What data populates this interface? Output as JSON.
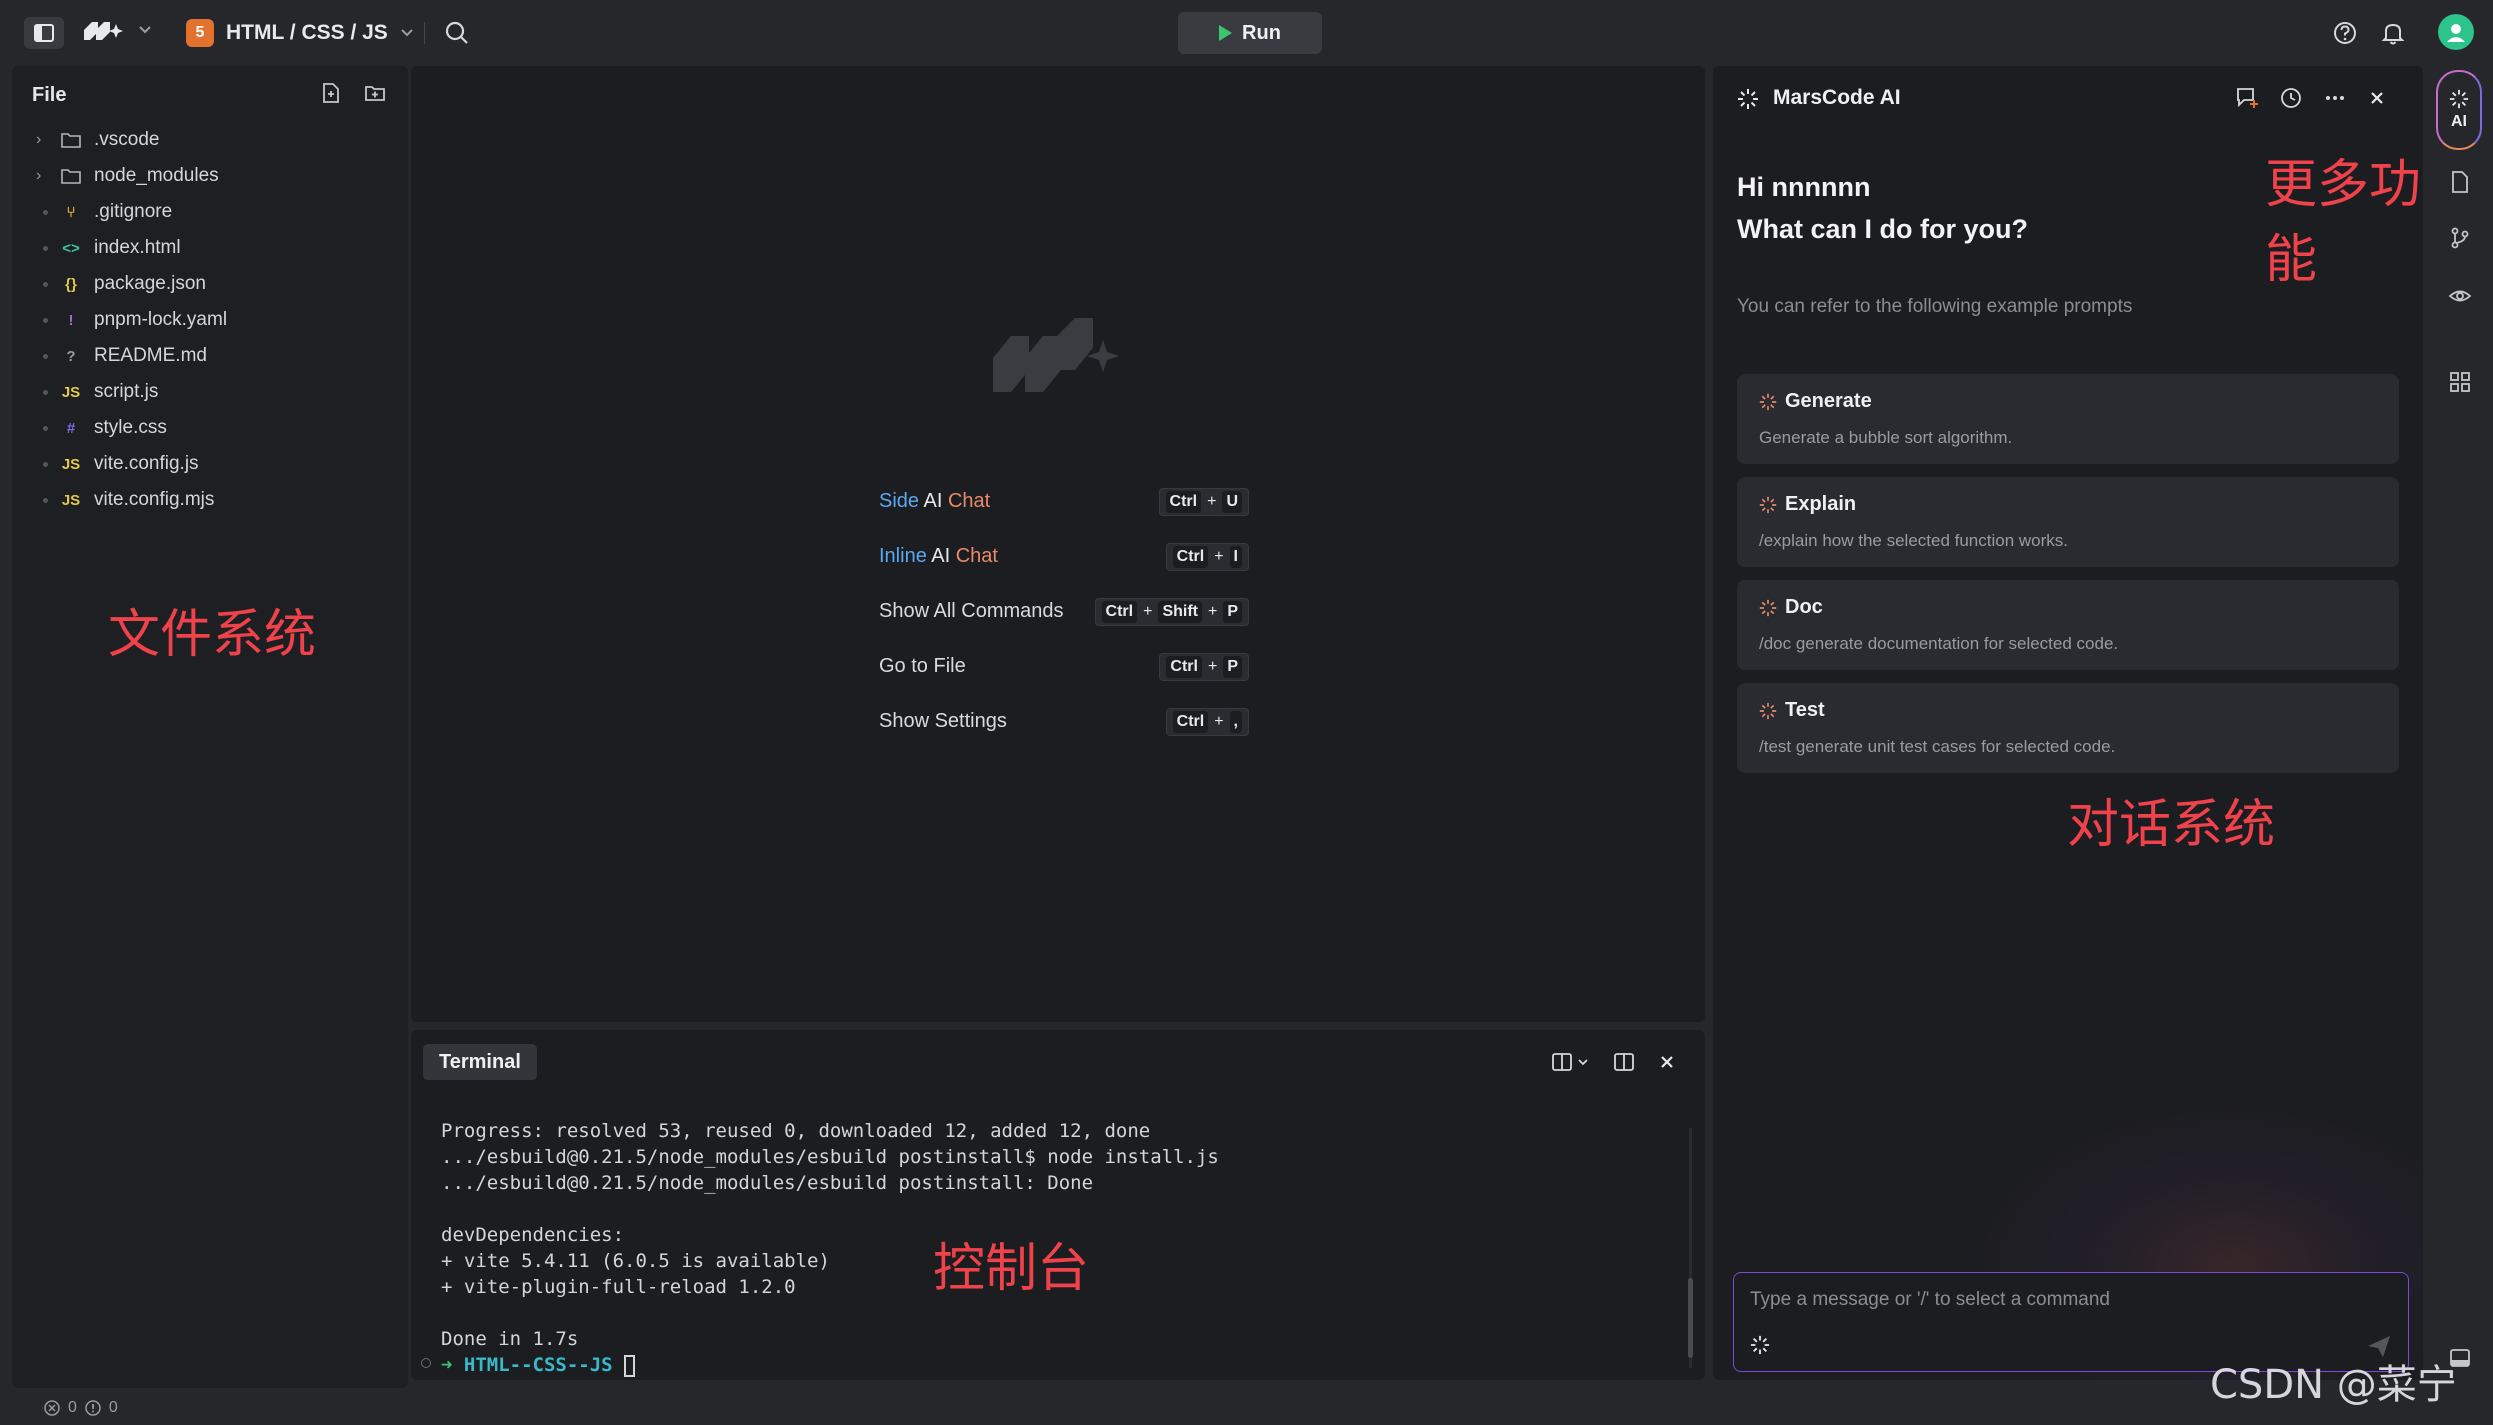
{
  "topbar": {
    "project": "HTML / CSS / JS",
    "run_label": "Run"
  },
  "files": {
    "title": "File",
    "items": [
      {
        "name": ".vscode",
        "kind": "folder"
      },
      {
        "name": "node_modules",
        "kind": "folder"
      },
      {
        "name": ".gitignore",
        "kind": "git"
      },
      {
        "name": "index.html",
        "kind": "html"
      },
      {
        "name": "package.json",
        "kind": "json"
      },
      {
        "name": "pnpm-lock.yaml",
        "kind": "yaml"
      },
      {
        "name": "README.md",
        "kind": "md"
      },
      {
        "name": "script.js",
        "kind": "js"
      },
      {
        "name": "style.css",
        "kind": "css"
      },
      {
        "name": "vite.config.js",
        "kind": "js"
      },
      {
        "name": "vite.config.mjs",
        "kind": "js"
      }
    ],
    "icon_glyphs": {
      "git": "⑂",
      "html": "<>",
      "json": "{}",
      "yaml": "!",
      "md": "?",
      "js": "JS",
      "css": "#"
    },
    "annotation": "文件系统"
  },
  "editor": {
    "shortcuts": [
      {
        "label_parts": [
          "Side",
          " AI",
          " Chat"
        ],
        "keys": [
          "Ctrl",
          "U"
        ]
      },
      {
        "label_parts": [
          "Inline",
          " AI",
          " Chat"
        ],
        "keys": [
          "Ctrl",
          "I"
        ]
      },
      {
        "label_parts": [
          "Show All Commands"
        ],
        "keys": [
          "Ctrl",
          "Shift",
          "P"
        ]
      },
      {
        "label_parts": [
          "Go to File"
        ],
        "keys": [
          "Ctrl",
          "P"
        ]
      },
      {
        "label_parts": [
          "Show Settings"
        ],
        "keys": [
          "Ctrl",
          ","
        ]
      }
    ]
  },
  "terminal": {
    "tab_label": "Terminal",
    "lines": [
      "Progress: resolved 53, reused 0, downloaded 12, added 12, done",
      ".../esbuild@0.21.5/node_modules/esbuild postinstall$ node install.js",
      ".../esbuild@0.21.5/node_modules/esbuild postinstall: Done",
      "",
      "devDependencies:",
      "+ vite 5.4.11 (6.0.5 is available)",
      "+ vite-plugin-full-reload 1.2.0",
      "",
      "Done in 1.7s"
    ],
    "prompt_arrow": "➜",
    "prompt_dir": "HTML--CSS--JS",
    "annotation": "控制台"
  },
  "ai": {
    "title": "MarsCode AI",
    "greeting_line1": "Hi nnnnnn",
    "greeting_line2": "What can I do for you?",
    "hint": "You can refer to the following example prompts",
    "cards": [
      {
        "title": "Generate",
        "desc": "Generate a bubble sort algorithm."
      },
      {
        "title": "Explain",
        "desc": "/explain how the selected function works."
      },
      {
        "title": "Doc",
        "desc": "/doc generate documentation for selected code."
      },
      {
        "title": "Test",
        "desc": "/test generate unit test cases for selected code."
      }
    ],
    "composer_placeholder": "Type a message or '/' to select a command",
    "annotation_features": "更多功能",
    "annotation_chat": "对话系统"
  },
  "rail": {
    "ai_label": "AI"
  },
  "status": {
    "errors": "0",
    "warnings": "0"
  },
  "watermark": "CSDN @菜宁",
  "colors": {
    "accent_green": "#3ec46d",
    "annotation_red": "#f0424b",
    "composer_border": "#7a4bd6",
    "html5_orange": "#e3722f"
  }
}
